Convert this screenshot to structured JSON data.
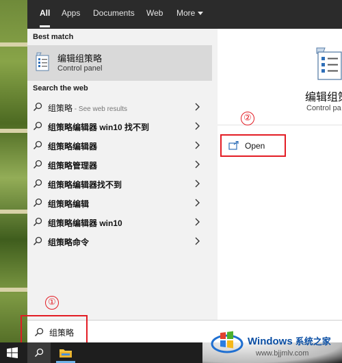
{
  "tabs": [
    {
      "label": "All",
      "active": true
    },
    {
      "label": "Apps",
      "active": false
    },
    {
      "label": "Documents",
      "active": false
    },
    {
      "label": "Web",
      "active": false
    },
    {
      "label": "More",
      "active": false
    }
  ],
  "best_match": {
    "heading": "Best match",
    "title": "编辑组策略",
    "subtitle": "Control panel",
    "icon": "control-panel-icon"
  },
  "web": {
    "heading": "Search the web",
    "results": [
      {
        "query": "组策略",
        "suffix": " - See web results"
      },
      {
        "query": "组策略编辑器 win10 找不到",
        "suffix": ""
      },
      {
        "query": "组策略编辑器",
        "suffix": ""
      },
      {
        "query": "组策略管理器",
        "suffix": ""
      },
      {
        "query": "组策略编辑器找不到",
        "suffix": ""
      },
      {
        "query": "组策略编辑",
        "suffix": ""
      },
      {
        "query": "组策略编辑器 win10",
        "suffix": ""
      },
      {
        "query": "组策略命令",
        "suffix": ""
      }
    ]
  },
  "preview": {
    "title": "编辑组策",
    "subtitle": "Control pa",
    "open_label": "Open"
  },
  "search": {
    "value": "组策略"
  },
  "annotations": {
    "one": "①",
    "two": "②"
  },
  "watermark": {
    "brand": "Windows",
    "brand_cn": "系统之家",
    "url": "www.bjjmlv.com"
  },
  "colors": {
    "accent_red": "#e31b23",
    "tabbar": "#2b2b2b",
    "selected_row": "#d9d9d9",
    "watermark_blue": "#0a4ea3"
  }
}
